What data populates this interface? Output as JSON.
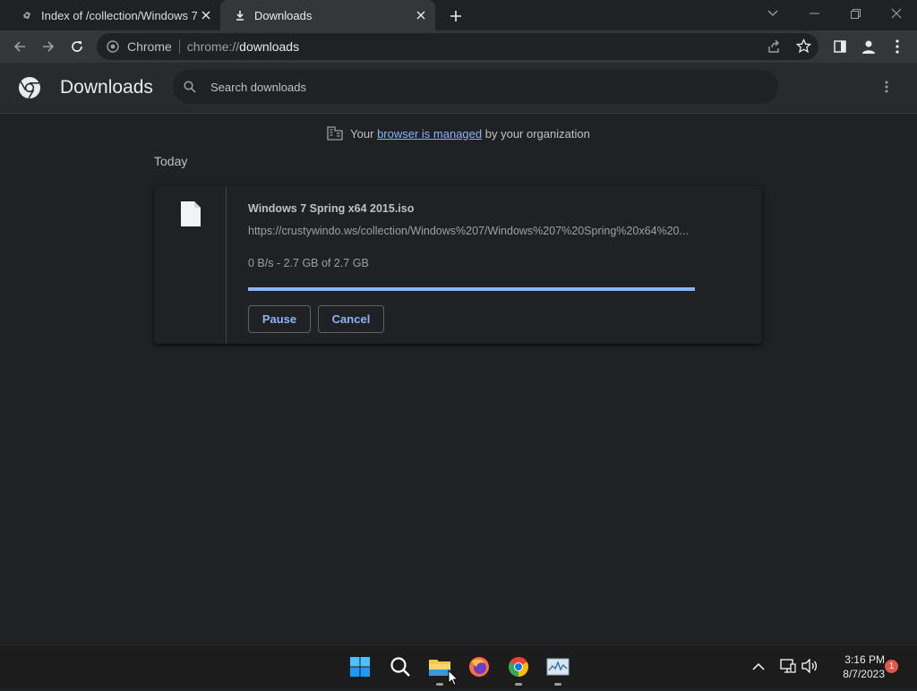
{
  "browser": {
    "tabs": [
      {
        "title": "Index of /collection/Windows 7/",
        "active": false,
        "icon": "page-icon"
      },
      {
        "title": "Downloads",
        "active": true,
        "icon": "download-icon"
      }
    ],
    "omnibox": {
      "site_name": "Chrome",
      "url_scheme": "chrome://",
      "url_host": "downloads"
    }
  },
  "downloads": {
    "title": "Downloads",
    "search_placeholder": "Search downloads",
    "managed_notice": {
      "prefix": "Your",
      "link": "browser is managed",
      "suffix": "by your organization"
    },
    "section_label": "Today",
    "items": [
      {
        "file_name": "Windows 7 Spring x64 2015.iso",
        "url": "https://crustywindo.ws/collection/Windows%207/Windows%207%20Spring%20x64%20...",
        "status": "0 B/s - 2.7 GB of 2.7 GB",
        "progress_percent": 100,
        "pause_label": "Pause",
        "cancel_label": "Cancel"
      }
    ]
  },
  "taskbar": {
    "apps": [
      "start-icon",
      "search-icon",
      "file-explorer-icon",
      "firefox-icon",
      "chrome-icon",
      "task-manager-icon"
    ],
    "clock_time": "3:16 PM",
    "clock_date": "8/7/2023",
    "notification_count": "1"
  },
  "colors": {
    "background": "#202124",
    "accent": "#8ab4f8",
    "header": "#292a2d",
    "toolbar": "#35363a"
  }
}
